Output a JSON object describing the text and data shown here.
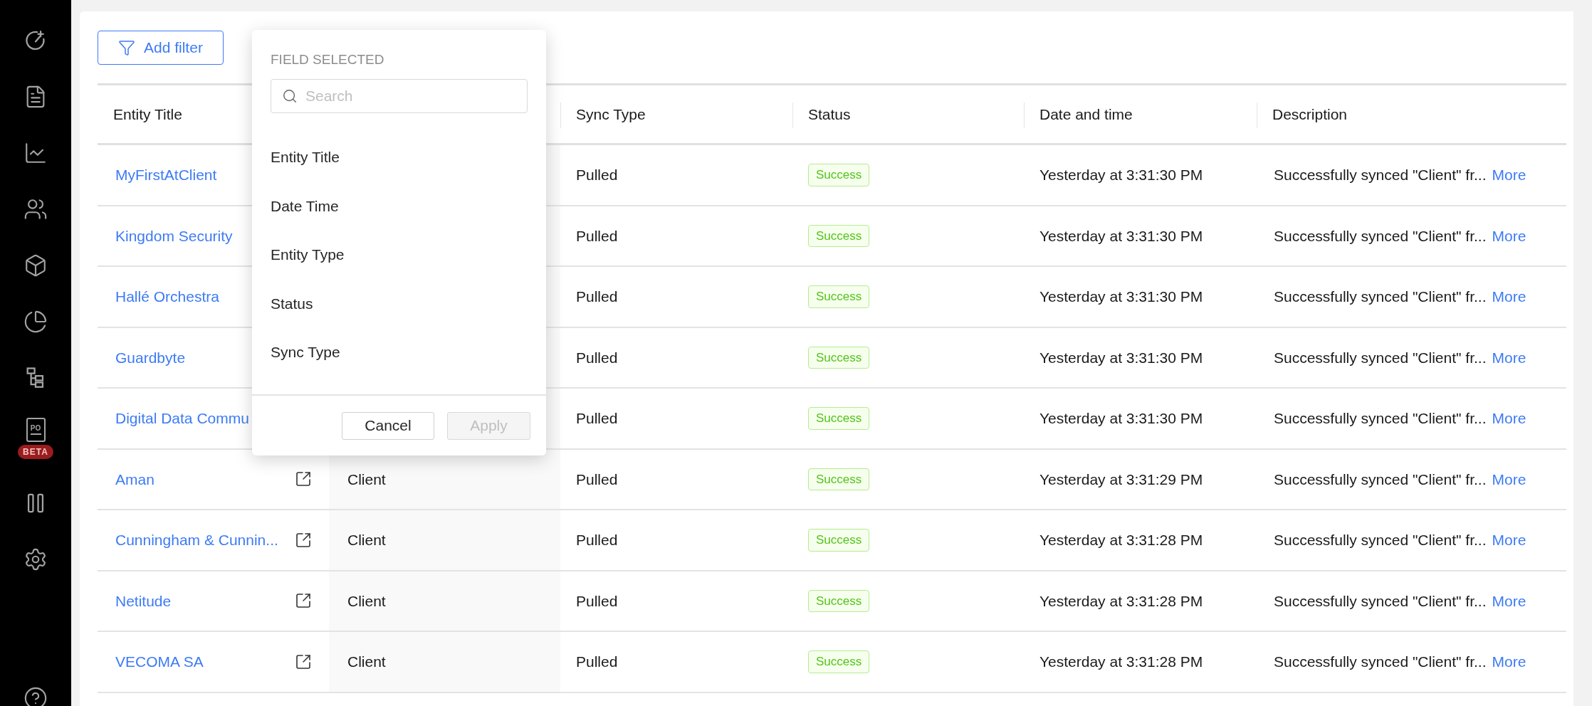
{
  "sidebar": {
    "doc_icon_text": "PO",
    "badge": "BETA"
  },
  "toolbar": {
    "add_filter": "Add filter"
  },
  "table": {
    "columns": [
      "Entity Title",
      "Sync Type",
      "Status",
      "Date and time",
      "Description"
    ],
    "rows": [
      {
        "entity_title": "MyFirstAtClient",
        "sync_type": "Pulled",
        "status": "Success",
        "date_time": "Yesterday at 3:31:30 PM",
        "description": "Successfully synced \"Client\" fr...",
        "more": "More"
      },
      {
        "entity_title": "Kingdom Security",
        "sync_type": "Pulled",
        "status": "Success",
        "date_time": "Yesterday at 3:31:30 PM",
        "description": "Successfully synced \"Client\" fr...",
        "more": "More"
      },
      {
        "entity_title": "Hallé Orchestra",
        "sync_type": "Pulled",
        "status": "Success",
        "date_time": "Yesterday at 3:31:30 PM",
        "description": "Successfully synced \"Client\" fr...",
        "more": "More"
      },
      {
        "entity_title": "Guardbyte",
        "sync_type": "Pulled",
        "status": "Success",
        "date_time": "Yesterday at 3:31:30 PM",
        "description": "Successfully synced \"Client\" fr...",
        "more": "More"
      },
      {
        "entity_title": "Digital Data Commu",
        "sync_type": "Pulled",
        "status": "Success",
        "date_time": "Yesterday at 3:31:30 PM",
        "description": "Successfully synced \"Client\" fr...",
        "more": "More"
      },
      {
        "entity_title": "Aman",
        "column_2": "Client",
        "sync_type": "Pulled",
        "status": "Success",
        "date_time": "Yesterday at 3:31:29 PM",
        "description": "Successfully synced \"Client\" fr...",
        "more": "More"
      },
      {
        "entity_title": "Cunningham & Cunnin...",
        "column_2": "Client",
        "sync_type": "Pulled",
        "status": "Success",
        "date_time": "Yesterday at 3:31:28 PM",
        "description": "Successfully synced \"Client\" fr...",
        "more": "More"
      },
      {
        "entity_title": "Netitude",
        "column_2": "Client",
        "sync_type": "Pulled",
        "status": "Success",
        "date_time": "Yesterday at 3:31:28 PM",
        "description": "Successfully synced \"Client\" fr...",
        "more": "More"
      },
      {
        "entity_title": "VECOMA SA",
        "column_2": "Client",
        "sync_type": "Pulled",
        "status": "Success",
        "date_time": "Yesterday at 3:31:28 PM",
        "description": "Successfully synced \"Client\" fr...",
        "more": "More"
      }
    ]
  },
  "filter_popup": {
    "title": "FIELD SELECTED",
    "search": {
      "placeholder": "Search"
    },
    "options": [
      {
        "label": "Entity Title"
      },
      {
        "label": "Date Time"
      },
      {
        "label": "Entity Type"
      },
      {
        "label": "Status"
      },
      {
        "label": "Sync Type"
      }
    ],
    "buttons": [
      {
        "label": "Cancel",
        "disabled": false
      },
      {
        "label": "Apply",
        "disabled": true
      }
    ]
  }
}
